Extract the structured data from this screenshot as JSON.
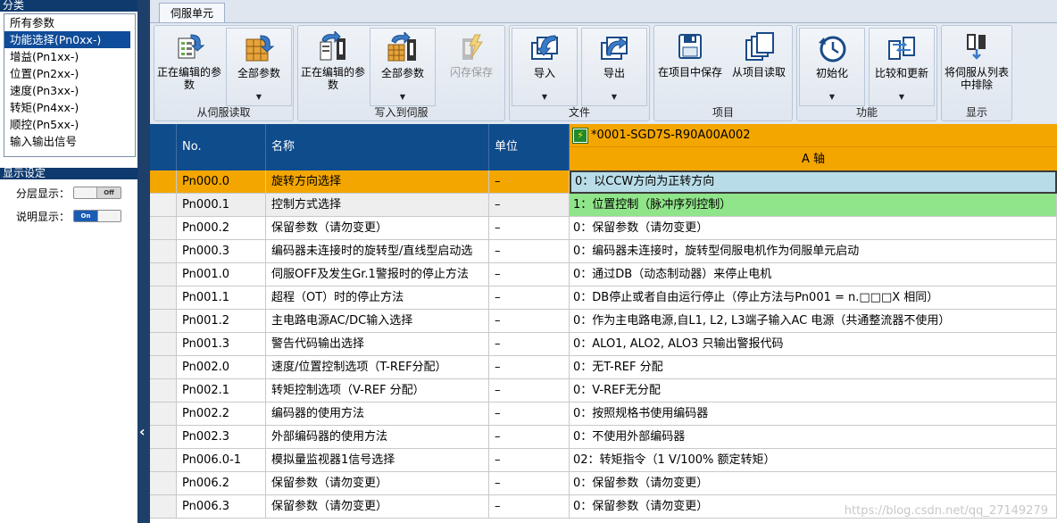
{
  "left": {
    "category_header": "分类",
    "categories": [
      {
        "label": "所有参数",
        "selected": false
      },
      {
        "label": "功能选择(Pn0xx-)",
        "selected": true
      },
      {
        "label": "增益(Pn1xx-)",
        "selected": false
      },
      {
        "label": "位置(Pn2xx-)",
        "selected": false
      },
      {
        "label": "速度(Pn3xx-)",
        "selected": false
      },
      {
        "label": "转矩(Pn4xx-)",
        "selected": false
      },
      {
        "label": "顺控(Pn5xx-)",
        "selected": false
      },
      {
        "label": "输入输出信号",
        "selected": false
      }
    ],
    "display_header": "显示设定",
    "layer_display_label": "分层显示：",
    "layer_display_state": "Off",
    "desc_display_label": "说明显示：",
    "desc_display_state": "On"
  },
  "splitter": {
    "collapse_glyph": "‹"
  },
  "ribbon": {
    "tab_label": "伺服单元",
    "groups": {
      "read": {
        "label": "从伺服读取",
        "btn_editing": "正在编辑的参数",
        "btn_all": "全部参数"
      },
      "write": {
        "label": "写入到伺服",
        "btn_editing": "正在编辑的参数",
        "btn_all": "全部参数",
        "btn_flash": "闪存保存"
      },
      "file": {
        "label": "文件",
        "btn_import": "导入",
        "btn_export": "导出"
      },
      "project": {
        "label": "项目",
        "btn_save": "在项目中保存",
        "btn_load": "从项目读取"
      },
      "function": {
        "label": "功能",
        "btn_init": "初始化",
        "btn_compare": "比较和更新"
      },
      "display": {
        "label": "显示",
        "btn_remove": "将伺服从列表中排除"
      }
    },
    "dropdown_glyph": "▼"
  },
  "grid": {
    "headers": {
      "no": "No.",
      "name": "名称",
      "unit": "单位"
    },
    "device_name": "*0001-SGD7S-R90A00A002",
    "axis_label": "A 轴",
    "rows": [
      {
        "no": "Pn000.0",
        "name": "旋转方向选择",
        "unit": "–",
        "value": "0：以CCW方向为正转方向"
      },
      {
        "no": "Pn000.1",
        "name": "控制方式选择",
        "unit": "–",
        "value": "1：位置控制（脉冲序列控制）"
      },
      {
        "no": "Pn000.2",
        "name": "保留参数（请勿变更）",
        "unit": "–",
        "value": "0：保留参数（请勿变更）"
      },
      {
        "no": "Pn000.3",
        "name": "编码器未连接时的旋转型/直线型启动选",
        "unit": "–",
        "value": "0：编码器未连接时，旋转型伺服电机作为伺服单元启动"
      },
      {
        "no": "Pn001.0",
        "name": "伺服OFF及发生Gr.1警报时的停止方法",
        "unit": "–",
        "value": "0：通过DB（动态制动器）来停止电机"
      },
      {
        "no": "Pn001.1",
        "name": "超程（OT）时的停止方法",
        "unit": "–",
        "value": "0：DB停止或者自由运行停止（停止方法与Pn001 = n.□□□X 相同）"
      },
      {
        "no": "Pn001.2",
        "name": "主电路电源AC/DC输入选择",
        "unit": "–",
        "value": "0：作为主电路电源,自L1, L2, L3端子输入AC 电源（共通整流器不使用）"
      },
      {
        "no": "Pn001.3",
        "name": "警告代码输出选择",
        "unit": "–",
        "value": "0：ALO1, ALO2, ALO3 只输出警报代码"
      },
      {
        "no": "Pn002.0",
        "name": "速度/位置控制选项（T-REF分配）",
        "unit": "–",
        "value": "0：无T-REF 分配"
      },
      {
        "no": "Pn002.1",
        "name": "转矩控制选项（V-REF 分配）",
        "unit": "–",
        "value": "0：V-REF无分配"
      },
      {
        "no": "Pn002.2",
        "name": "编码器的使用方法",
        "unit": "–",
        "value": "0：按照规格书使用编码器"
      },
      {
        "no": "Pn002.3",
        "name": "外部编码器的使用方法",
        "unit": "–",
        "value": "0：不使用外部编码器"
      },
      {
        "no": "Pn006.0-1",
        "name": "模拟量监视器1信号选择",
        "unit": "–",
        "value": "02：转矩指令（1 V/100% 额定转矩）"
      },
      {
        "no": "Pn006.2",
        "name": "保留参数（请勿变更）",
        "unit": "–",
        "value": "0：保留参数（请勿变更）"
      },
      {
        "no": "Pn006.3",
        "name": "保留参数（请勿变更）",
        "unit": "–",
        "value": "0：保留参数（请勿变更）"
      }
    ]
  },
  "watermark": "https://blog.csdn.net/qq_27149279",
  "colors": {
    "header_blue": "#0f4c8c",
    "selection_orange": "#f4a600",
    "changed_green": "#90e48a",
    "focused_cell": "#b8dce8"
  }
}
